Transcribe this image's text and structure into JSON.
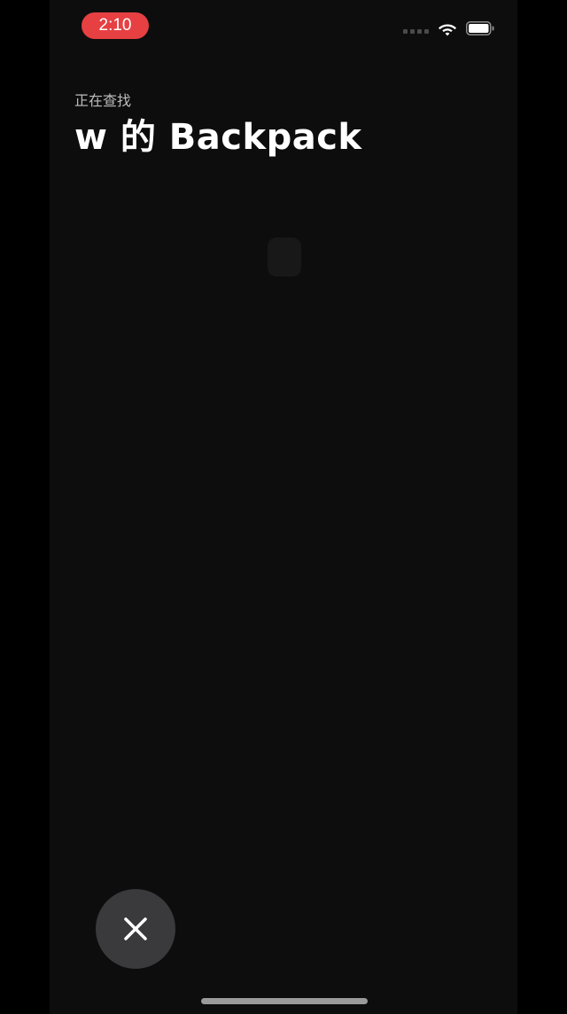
{
  "status_bar": {
    "time": "2:10",
    "icons": [
      "cellular-signal-icon",
      "wifi-icon",
      "battery-icon"
    ]
  },
  "header": {
    "subtitle": "正在查找",
    "title": "w 的 Backpack"
  },
  "controls": {
    "close_icon": "close-icon"
  },
  "colors": {
    "time_pill": "#e64042",
    "background": "#0d0d0d",
    "close_button": "#3a3a3c"
  }
}
